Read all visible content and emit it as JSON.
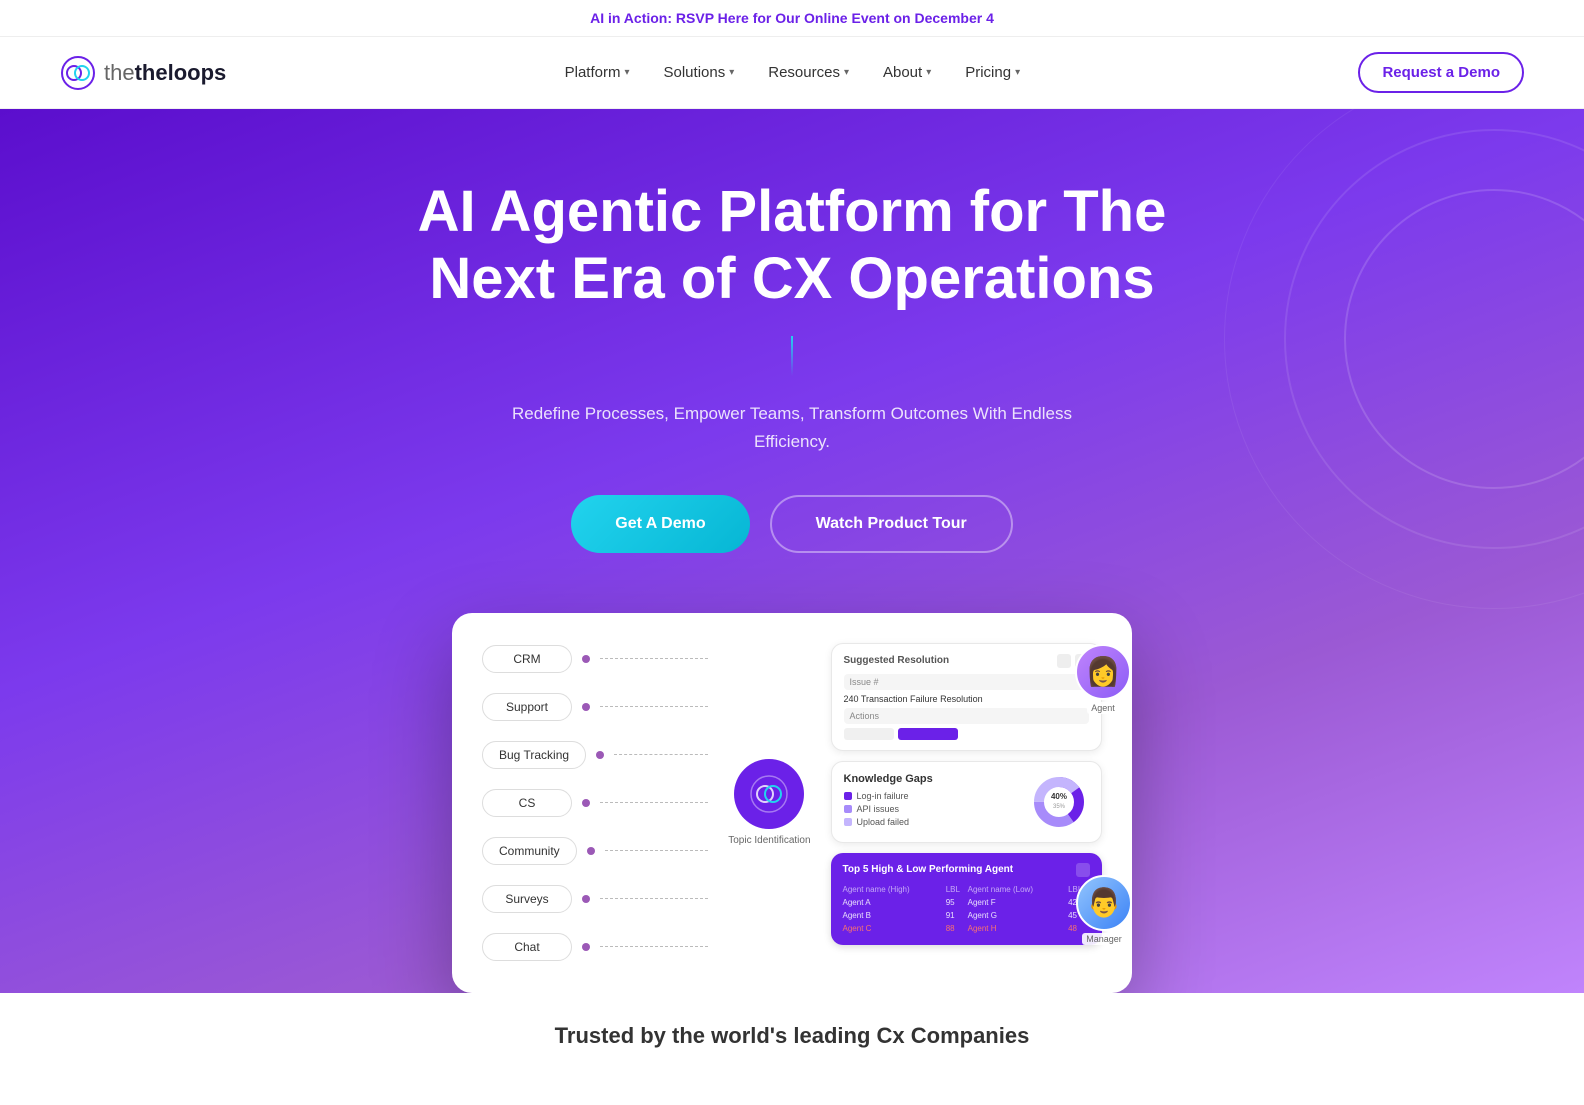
{
  "banner": {
    "prefix": "AI in Action:",
    "text": " RSVP Here for Our Online Event on December 4"
  },
  "nav": {
    "logo_text": "theloops",
    "links": [
      {
        "label": "Platform",
        "has_dropdown": true
      },
      {
        "label": "Solutions",
        "has_dropdown": true
      },
      {
        "label": "Resources",
        "has_dropdown": true
      },
      {
        "label": "About",
        "has_dropdown": true
      },
      {
        "label": "Pricing",
        "has_dropdown": true
      }
    ],
    "cta_label": "Request a Demo"
  },
  "hero": {
    "title": "AI Agentic Platform for The Next Era of CX Operations",
    "subtitle": "Redefine Processes, Empower Teams, Transform Outcomes With Endless Efficiency.",
    "btn_demo": "Get A Demo",
    "btn_tour": "Watch Product Tour"
  },
  "dashboard": {
    "nodes": [
      {
        "label": "CRM"
      },
      {
        "label": "Support"
      },
      {
        "label": "Bug Tracking"
      },
      {
        "label": "CS"
      },
      {
        "label": "Community"
      },
      {
        "label": "Surveys"
      },
      {
        "label": "Chat"
      }
    ],
    "hub_label": "Topic Identification",
    "resolution_card": {
      "title": "Suggested Resolution",
      "issue_label": "Issue #",
      "resolution_label": "Resolution",
      "agent_label": "Agent"
    },
    "knowledge_card": {
      "title": "Knowledge Gaps",
      "items": [
        {
          "label": "Log-in failure",
          "color": "#6b21e8",
          "pct": 40
        },
        {
          "label": "API issues",
          "color": "#a78bfa",
          "pct": 35
        },
        {
          "label": "Upload failed",
          "color": "#c4b5fd",
          "pct": 25
        }
      ]
    },
    "performer_card": {
      "title": "Top 5 High & Low Performing Agent",
      "col1": "Agent name (High)",
      "col2": "LBL",
      "col3": "Agent name (Low)",
      "col4": "LBL",
      "manager_label": "Manager"
    }
  },
  "trusted": {
    "text": "Trusted by the world's leading Cx Companies"
  }
}
